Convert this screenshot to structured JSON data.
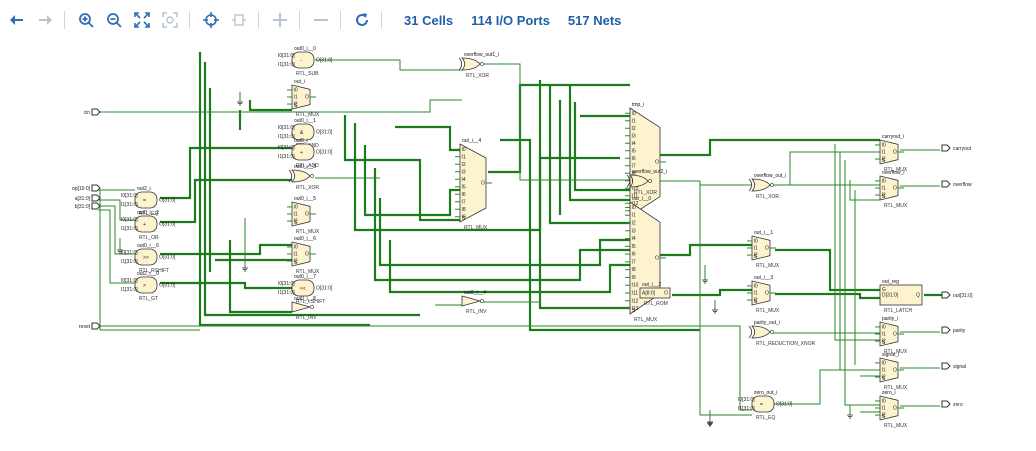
{
  "toolbar": {
    "buttons": [
      {
        "name": "back-button",
        "icon": "arrow-left-icon",
        "enabled": true
      },
      {
        "name": "forward-button",
        "icon": "arrow-right-icon",
        "enabled": false
      },
      {
        "name": "zoom-in-button",
        "icon": "zoom-in-icon",
        "enabled": true
      },
      {
        "name": "zoom-out-button",
        "icon": "zoom-out-icon",
        "enabled": true
      },
      {
        "name": "zoom-fit-button",
        "icon": "fit-icon",
        "enabled": true
      },
      {
        "name": "zoom-area-button",
        "icon": "zoom-area-icon",
        "enabled": false
      },
      {
        "name": "center-button",
        "icon": "crosshair-icon",
        "enabled": true
      },
      {
        "name": "auto-fit-button",
        "icon": "fit-selection-icon",
        "enabled": false
      },
      {
        "name": "expand-button",
        "icon": "plus-icon",
        "enabled": false
      },
      {
        "name": "collapse-button",
        "icon": "minus-icon",
        "enabled": false
      },
      {
        "name": "regenerate-button",
        "icon": "refresh-icon",
        "enabled": true
      }
    ],
    "cells_label": "31 Cells",
    "ports_label": "114 I/O Ports",
    "nets_label": "517 Nets"
  },
  "colors": {
    "accent": "#1f5faa",
    "wire": "#2a8a2a",
    "bus": "#1d7a1d",
    "cell_fill": "#fdf4cf"
  },
  "schematic": {
    "inputs": [
      {
        "id": "in_cin",
        "label": "cin"
      },
      {
        "id": "in_op",
        "label": "op[10:0]"
      },
      {
        "id": "in_a",
        "label": "a[31:0]"
      },
      {
        "id": "in_b",
        "label": "b[31:0]"
      },
      {
        "id": "in_reset",
        "label": "reset"
      }
    ],
    "outputs": [
      {
        "id": "out_carry",
        "label": "carryout"
      },
      {
        "id": "out_ovf",
        "label": "overflow"
      },
      {
        "id": "out_out",
        "label": "out[31:0]"
      },
      {
        "id": "out_parity",
        "label": "parity"
      },
      {
        "id": "out_signal",
        "label": "signal"
      },
      {
        "id": "out_zero",
        "label": "zero"
      }
    ],
    "cells": [
      {
        "id": "c_eq1",
        "name": "out2_i",
        "type": "RTL_EQ",
        "shape": "op",
        "sym": "="
      },
      {
        "id": "c_or",
        "name": "out0_i__2",
        "type": "RTL_OR",
        "shape": "op",
        "sym": "+"
      },
      {
        "id": "c_rsh",
        "name": "out0_i__6",
        "type": "RTL_RSHIFT",
        "shape": "op",
        "sym": ">>"
      },
      {
        "id": "c_gt",
        "name": "out2_i__0",
        "type": "RTL_GT",
        "shape": "op",
        "sym": ">"
      },
      {
        "id": "c_sub",
        "name": "out0_i__0",
        "type": "RTL_SUB",
        "shape": "op",
        "sym": "-"
      },
      {
        "id": "c_mux1",
        "name": "out_i",
        "type": "RTL_MUX",
        "shape": "mux"
      },
      {
        "id": "c_and",
        "name": "out0_i__1",
        "type": "RTL_AND",
        "shape": "op",
        "sym": "&"
      },
      {
        "id": "c_add",
        "name": "out0_i",
        "type": "RTL_ADD",
        "shape": "op",
        "sym": "+"
      },
      {
        "id": "c_xor1",
        "name": "out0_i__3",
        "type": "RTL_XOR",
        "shape": "xor"
      },
      {
        "id": "c_mux3",
        "name": "out0_i__5",
        "type": "RTL_MUX",
        "shape": "mux"
      },
      {
        "id": "c_mux4",
        "name": "out0_i__6",
        "type": "RTL_MUX",
        "shape": "mux"
      },
      {
        "id": "c_lsh",
        "name": "out0_i__7",
        "type": "RTL_LSHIFT",
        "shape": "op",
        "sym": "<<"
      },
      {
        "id": "c_inv1",
        "name": "out0_i__8",
        "type": "RTL_INV",
        "shape": "inv"
      },
      {
        "id": "c_xor2",
        "name": "overflow_out1_i",
        "type": "RTL_XOR",
        "shape": "xor"
      },
      {
        "id": "c_bigmux1",
        "name": "out_i__4",
        "type": "RTL_MUX",
        "shape": "mux"
      },
      {
        "id": "c_inv2",
        "name": "out0_i__4",
        "type": "RTL_INV",
        "shape": "inv"
      },
      {
        "id": "c_tmp",
        "name": "tmp_i",
        "type": "RTL_MUX",
        "shape": "mux"
      },
      {
        "id": "c_xor3",
        "name": "overflow_out2_i",
        "type": "RTL_XOR",
        "shape": "xor"
      },
      {
        "id": "c_bigmux2",
        "name": "out_i__0",
        "type": "RTL_MUX",
        "shape": "mux"
      },
      {
        "id": "c_rom",
        "name": "out_i__2",
        "type": "RTL_ROM",
        "shape": "rom"
      },
      {
        "id": "c_xor4",
        "name": "overflow_out_i",
        "type": "RTL_XOR",
        "shape": "xor"
      },
      {
        "id": "c_mux5",
        "name": "out_i__1",
        "type": "RTL_MUX",
        "shape": "mux"
      },
      {
        "id": "c_mux6",
        "name": "out_i__3",
        "type": "RTL_MUX",
        "shape": "mux"
      },
      {
        "id": "c_redx",
        "name": "parity_out_i",
        "type": "RTL_REDUCTION_XNOR",
        "shape": "xor"
      },
      {
        "id": "c_zeq",
        "name": "zero_out_i",
        "type": "RTL_EQ",
        "shape": "op",
        "sym": "="
      },
      {
        "id": "c_carry",
        "name": "carryout_i",
        "type": "RTL_MUX",
        "shape": "mux"
      },
      {
        "id": "c_ovf",
        "name": "overflow_i",
        "type": "RTL_MUX",
        "shape": "mux"
      },
      {
        "id": "c_latch",
        "name": "out_reg",
        "type": "RTL_LATCH",
        "shape": "latch"
      },
      {
        "id": "c_parity",
        "name": "parity_i",
        "type": "RTL_MUX",
        "shape": "mux"
      },
      {
        "id": "c_signal",
        "name": "signal_i",
        "type": "RTL_MUX",
        "shape": "mux"
      },
      {
        "id": "c_zero",
        "name": "zero_i",
        "type": "RTL_MUX",
        "shape": "mux"
      }
    ]
  }
}
